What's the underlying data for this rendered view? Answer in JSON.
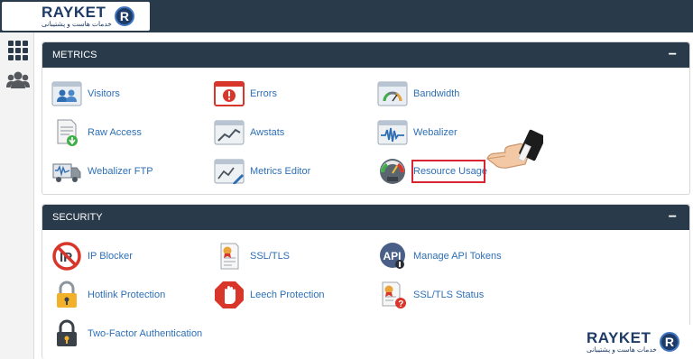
{
  "brand": {
    "name": "RAYKET",
    "tagline": "خدمات هاست و پشتیبانی",
    "mark": "R"
  },
  "sidebar": {
    "items": [
      {
        "name": "apps-grid-icon"
      },
      {
        "name": "users-icon"
      }
    ]
  },
  "metrics": {
    "title": "METRICS",
    "collapse": "−",
    "items": [
      {
        "label": "Visitors",
        "icon": "visitors-icon"
      },
      {
        "label": "Errors",
        "icon": "errors-icon"
      },
      {
        "label": "Bandwidth",
        "icon": "bandwidth-icon"
      },
      {
        "label": "Raw Access",
        "icon": "raw-access-icon"
      },
      {
        "label": "Awstats",
        "icon": "awstats-icon"
      },
      {
        "label": "Webalizer",
        "icon": "webalizer-icon"
      },
      {
        "label": "Webalizer FTP",
        "icon": "webalizer-ftp-icon"
      },
      {
        "label": "Metrics Editor",
        "icon": "metrics-editor-icon"
      },
      {
        "label": "Resource Usage",
        "icon": "resource-usage-icon"
      }
    ]
  },
  "security": {
    "title": "SECURITY",
    "collapse": "−",
    "items": [
      {
        "label": "IP Blocker",
        "icon": "ip-blocker-icon"
      },
      {
        "label": "SSL/TLS",
        "icon": "ssl-tls-icon"
      },
      {
        "label": "Manage API Tokens",
        "icon": "api-tokens-icon",
        "badge": "API"
      },
      {
        "label": "Hotlink Protection",
        "icon": "hotlink-lock-icon"
      },
      {
        "label": "Leech Protection",
        "icon": "leech-hand-icon"
      },
      {
        "label": "SSL/TLS Status",
        "icon": "ssl-status-icon"
      },
      {
        "label": "Two-Factor Authentication",
        "icon": "two-factor-lock-icon"
      }
    ]
  },
  "colors": {
    "header": "#293a4a",
    "link": "#2d6fb5",
    "highlight": "#d72631"
  }
}
